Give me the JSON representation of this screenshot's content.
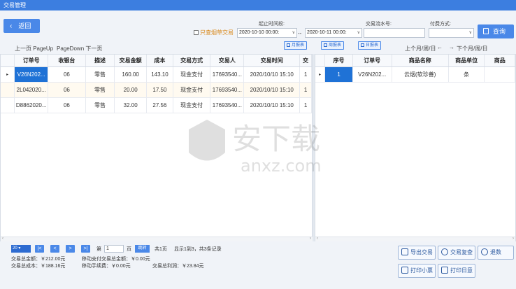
{
  "window": {
    "title": "交易管理"
  },
  "toolbar": {
    "back_label": "返回",
    "time_range_label": "起止时间段:",
    "only_tobacco_label": "只查烟草交易",
    "start_time": "2020-10-10 00:00:",
    "end_time": "2020-10-11 00:00:",
    "range_sep": "--",
    "serial_label": "交易流水号:",
    "serial_value": "",
    "payment_label": "付费方式:",
    "payment_value": "",
    "query_label": "查询"
  },
  "reports": {
    "month": "月报表",
    "week": "周报表",
    "day": "日报表"
  },
  "nav": {
    "page_up": "上一页 PageUp",
    "page_down": "PageDown 下一页",
    "period_prev": "上个月/周/日",
    "arrow_left": "←",
    "arrow_right": "→",
    "period_next": "下个月/周/日"
  },
  "left_grid": {
    "columns": [
      "订单号",
      "收银台",
      "描述",
      "交易金额",
      "成本",
      "交易方式",
      "交易人",
      "交易时间",
      "交"
    ],
    "rows": [
      [
        "V26N202...",
        "06",
        "零售",
        "160.00",
        "143.10",
        "现金支付",
        "17693540...",
        "2020/10/10 15:10",
        "1"
      ],
      [
        "2L042020...",
        "06",
        "零售",
        "20.00",
        "17.50",
        "现金支付",
        "17693540...",
        "2020/10/10 15:10",
        "1"
      ],
      [
        "D8862020...",
        "06",
        "零售",
        "32.00",
        "27.56",
        "现金支付",
        "17693540...",
        "2020/10/10 15:10",
        "1"
      ]
    ]
  },
  "right_grid": {
    "columns": [
      "序号",
      "订单号",
      "商品名称",
      "商品单位",
      "商品"
    ],
    "rows": [
      [
        "1",
        "V26N202...",
        "云烟(软珍善)",
        "条",
        ""
      ]
    ]
  },
  "pager": {
    "page_size": "20",
    "first": "|<",
    "prev": "<",
    "next": ">",
    "last": ">|",
    "page_prefix": "第",
    "page_value": "1",
    "page_suffix": "页",
    "jump": "跳转",
    "total_pages": "共1页",
    "record_info": "显示1到3，共3条记录"
  },
  "stats": {
    "total_amount": "交易总金额：￥212.00元",
    "mobile_total": "移动支付交易总金额：￥0.00元",
    "total_cost": "交易总成本：￥188.16元",
    "mobile_fee": "移动手续费：￥0.00元",
    "total_profit": "交易总利润：￥23.84元"
  },
  "actions": {
    "export": "导出交易",
    "recheck": "交易复查",
    "refund": "退数",
    "print_receipt": "打印小票",
    "print_daily": "打印日意"
  },
  "watermark": {
    "text": "安下载",
    "domain": "anxz.com"
  },
  "colors": {
    "accent": "#4a88e8",
    "selection": "#1f72d6",
    "titlebar": "#3c7ee0"
  }
}
